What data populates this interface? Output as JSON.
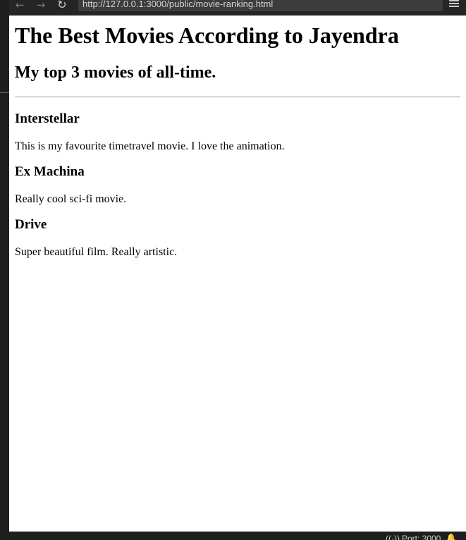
{
  "browser": {
    "url": "http://127.0.0.1:3000/public/movie-ranking.html",
    "back_icon": "←",
    "forward_icon": "→",
    "reload_icon": "↻",
    "menu_icon": "hamburger"
  },
  "page": {
    "title": "The Best Movies According to Jayendra",
    "subtitle": "My top 3 movies of all-time.",
    "movies": [
      {
        "name": "Interstellar",
        "description": "This is my favourite timetravel movie. I love the animation."
      },
      {
        "name": "Ex Machina",
        "description": "Really cool sci-fi movie."
      },
      {
        "name": "Drive",
        "description": "Super beautiful film. Really artistic."
      }
    ]
  },
  "statusbar": {
    "port_label": "Port: 3000",
    "broadcast_icon": "((·))",
    "notification_icon": "bell"
  },
  "colors": {
    "chrome_bg": "#1e1e1e",
    "url_bar_bg": "#3c3c3c",
    "page_bg": "#ffffff",
    "rule": "#9a9a9a"
  }
}
